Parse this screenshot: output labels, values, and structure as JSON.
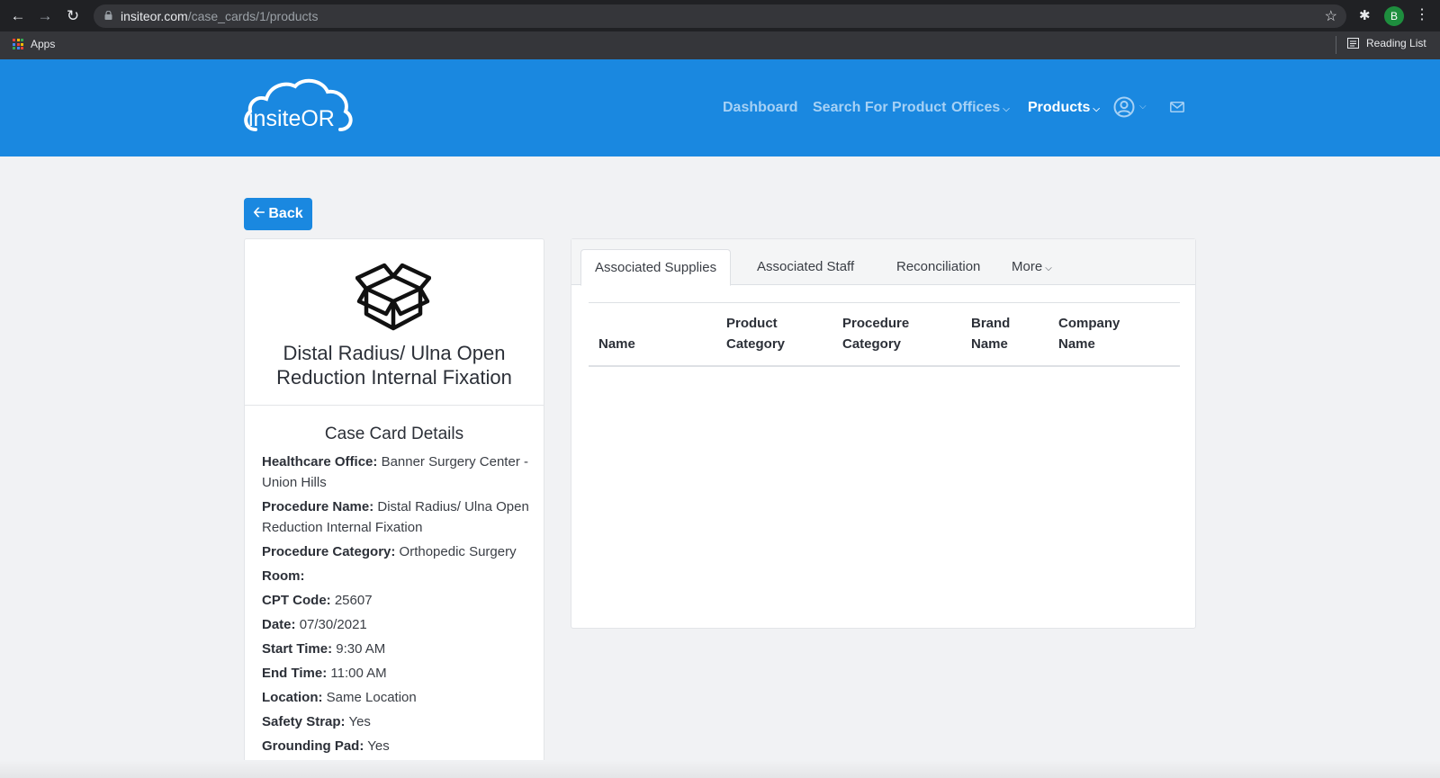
{
  "browser": {
    "url_host": "insiteor.com",
    "url_path": "/case_cards/1/products",
    "profile_initial": "B",
    "apps_label": "Apps",
    "reading_list_label": "Reading List"
  },
  "header": {
    "logo_text": "insiteOR",
    "nav": {
      "dashboard": "Dashboard",
      "search": "Search For Product",
      "offices": "Offices",
      "products": "Products"
    }
  },
  "back_label": "Back",
  "case_card": {
    "title": "Distal Radius/ Ulna Open Reduction Internal Fixation",
    "details_title": "Case Card Details",
    "details": [
      {
        "label": "Healthcare Office:",
        "value": "Banner Surgery Center - Union Hills"
      },
      {
        "label": "Procedure Name:",
        "value": "Distal Radius/ Ulna Open Reduction Internal Fixation"
      },
      {
        "label": "Procedure Category:",
        "value": "Orthopedic Surgery"
      },
      {
        "label": "Room:",
        "value": ""
      },
      {
        "label": "CPT Code:",
        "value": "25607"
      },
      {
        "label": "Date:",
        "value": "07/30/2021"
      },
      {
        "label": "Start Time:",
        "value": "9:30 AM"
      },
      {
        "label": "End Time:",
        "value": "11:00 AM"
      },
      {
        "label": "Location:",
        "value": "Same Location"
      },
      {
        "label": "Safety Strap:",
        "value": "Yes"
      },
      {
        "label": "Grounding Pad:",
        "value": "Yes"
      }
    ]
  },
  "tabs": {
    "supplies": "Associated Supplies",
    "staff": "Associated Staff",
    "reconciliation": "Reconciliation",
    "more": "More"
  },
  "table": {
    "headers": {
      "name": "Name",
      "product_category_1": "Product",
      "product_category_2": "Category",
      "procedure_category_1": "Procedure",
      "procedure_category_2": "Category",
      "brand_1": "Brand",
      "brand_2": "Name",
      "company_1": "Company",
      "company_2": "Name"
    }
  },
  "colors": {
    "brand_blue": "#1a88e0",
    "nav_inactive": "#a6d1f5"
  }
}
